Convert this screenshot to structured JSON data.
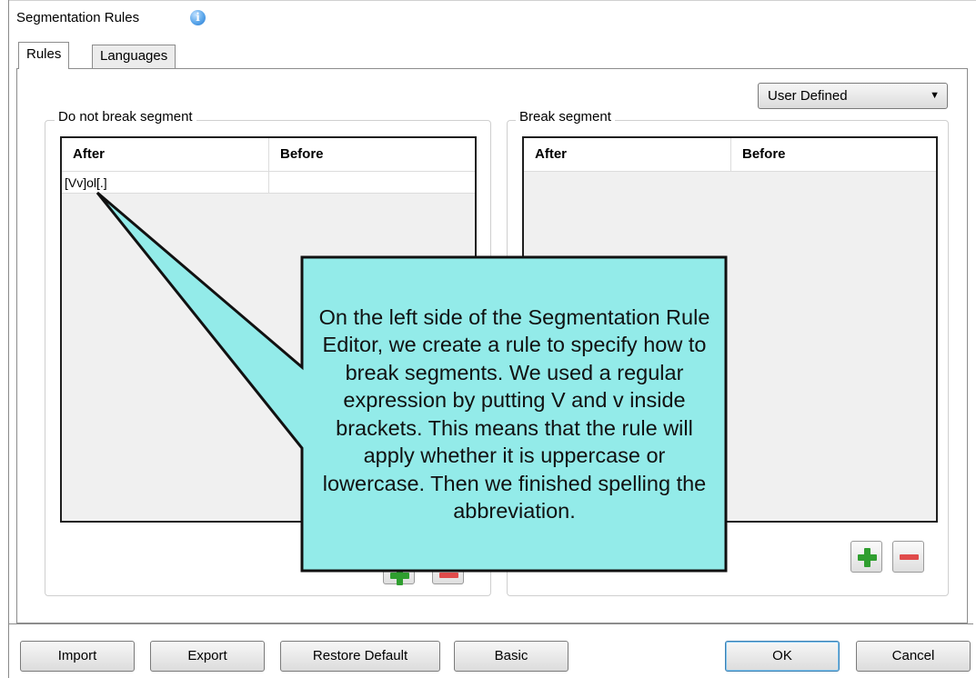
{
  "dialog": {
    "title": "Segmentation Rules"
  },
  "tabs": [
    {
      "label": "Rules"
    },
    {
      "label": "Languages"
    }
  ],
  "mode_select": {
    "value": "User Defined"
  },
  "groups": {
    "do_not_break": {
      "label": "Do not break segment",
      "columns": [
        "After",
        "Before"
      ],
      "rows": [
        {
          "after": "[Vv]ol[.]",
          "before": ""
        }
      ]
    },
    "break": {
      "label": "Break segment",
      "columns": [
        "After",
        "Before"
      ],
      "rows": []
    }
  },
  "buttons": {
    "import": "Import",
    "export": "Export",
    "restore_default": "Restore Default",
    "basic": "Basic",
    "ok": "OK",
    "cancel": "Cancel"
  },
  "callout": {
    "text": "On the left side of the Segmentation Rule Editor, we create a rule to specify how to break segments. We used a regular expression by putting V and v inside brackets. This means that the rule will apply whether it is uppercase or lowercase. Then we finished spelling the abbreviation."
  },
  "colors": {
    "callout_fill": "#93ebe9",
    "callout_border": "#111111",
    "add_icon": "#2f9e2f",
    "remove_icon": "#e04b4b",
    "info_icon": "#5aa6ea"
  },
  "icons": [
    "info-icon",
    "dropdown-arrow-icon",
    "plus-icon",
    "minus-icon"
  ]
}
